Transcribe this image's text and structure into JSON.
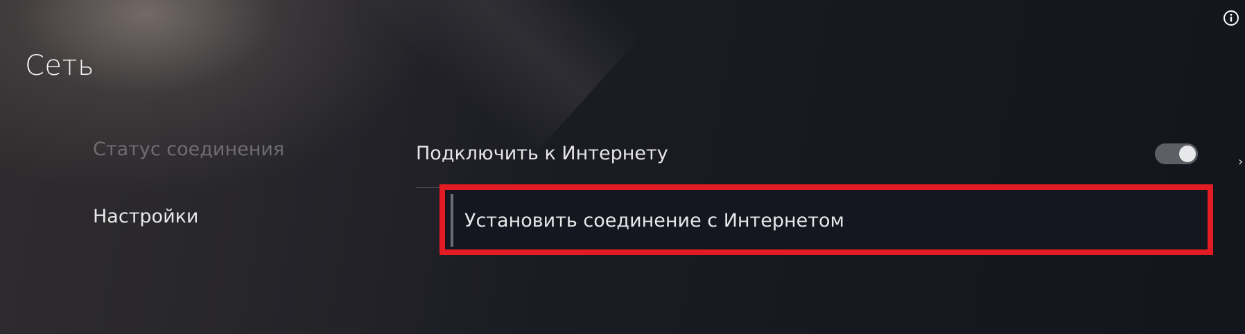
{
  "page": {
    "title": "Сеть"
  },
  "sidebar": {
    "items": [
      {
        "label": "Статус соединения",
        "state": "inactive"
      },
      {
        "label": "Настройки",
        "state": "active"
      }
    ]
  },
  "settings": {
    "connect_internet": {
      "label": "Подключить к Интернету",
      "enabled": true
    },
    "setup_connection": {
      "label": "Установить соединение с Интернетом"
    }
  },
  "icons": {
    "info": "info-icon",
    "arrow": "chevron-right-icon"
  },
  "colors": {
    "highlight_border": "#e31b23",
    "text_primary": "#e8e8ea",
    "text_dim": "#6f6d70"
  }
}
